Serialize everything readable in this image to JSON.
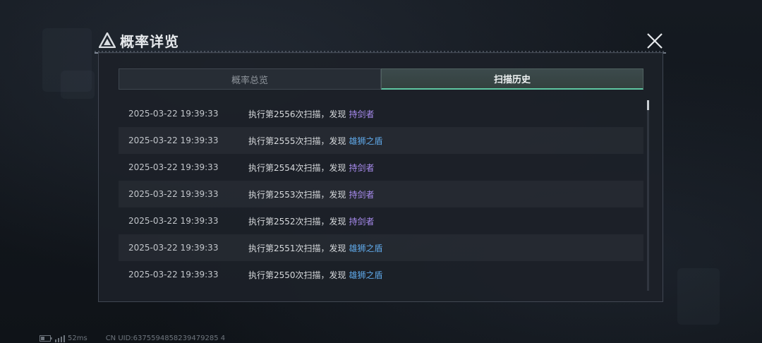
{
  "header": {
    "title": "概率详览"
  },
  "tabs": [
    {
      "label": "概率总览",
      "active": false
    },
    {
      "label": "扫描历史",
      "active": true
    }
  ],
  "history": [
    {
      "time": "2025-03-22 19:39:33",
      "desc": "执行第2556次扫描，发现",
      "item": "持剑者",
      "item_color": "#a98cf0"
    },
    {
      "time": "2025-03-22 19:39:33",
      "desc": "执行第2555次扫描，发现",
      "item": "雄狮之盾",
      "item_color": "#5fa8e8"
    },
    {
      "time": "2025-03-22 19:39:33",
      "desc": "执行第2554次扫描，发现",
      "item": "持剑者",
      "item_color": "#a98cf0"
    },
    {
      "time": "2025-03-22 19:39:33",
      "desc": "执行第2553次扫描，发现",
      "item": "持剑者",
      "item_color": "#a98cf0"
    },
    {
      "time": "2025-03-22 19:39:33",
      "desc": "执行第2552次扫描，发现",
      "item": "持剑者",
      "item_color": "#a98cf0"
    },
    {
      "time": "2025-03-22 19:39:33",
      "desc": "执行第2551次扫描，发现",
      "item": "雄狮之盾",
      "item_color": "#5fa8e8"
    },
    {
      "time": "2025-03-22 19:39:33",
      "desc": "执行第2550次扫描，发现",
      "item": "雄狮之盾",
      "item_color": "#5fa8e8"
    }
  ],
  "footer": {
    "ping": "52ms",
    "uid": "CN UID:6375594858239479285 4"
  },
  "colors": {
    "accent": "#5fc7a3",
    "rarity_purple": "#a98cf0",
    "rarity_blue": "#5fa8e8"
  },
  "icons": {
    "title": "triangle-logo-icon",
    "close": "close-icon",
    "battery": "battery-icon",
    "signal": "signal-icon"
  }
}
